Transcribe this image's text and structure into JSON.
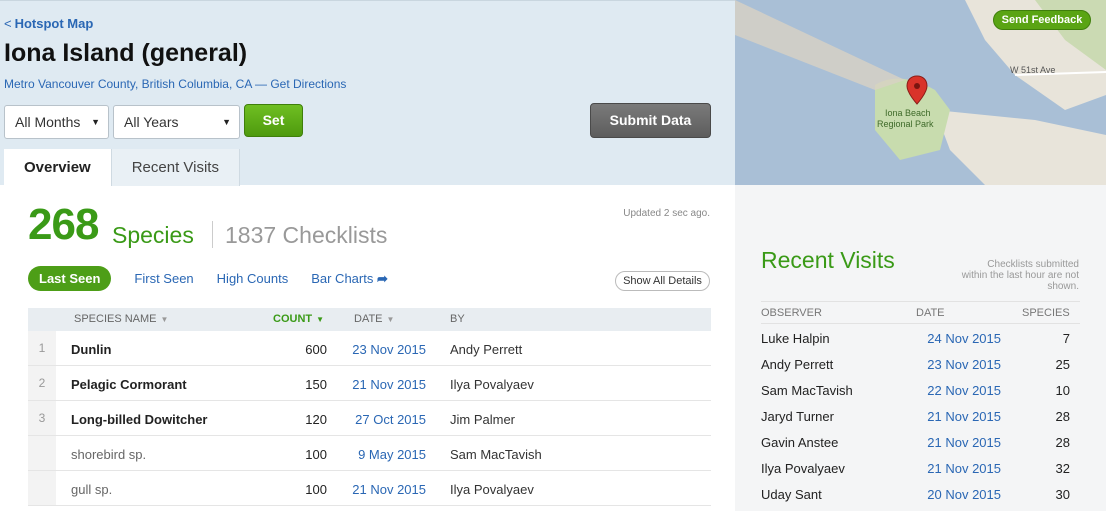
{
  "header": {
    "back_link": "Hotspot Map",
    "title": "Iona Island (general)",
    "location": "Metro Vancouver County, British Columbia, CA",
    "directions": "Get Directions",
    "month_select": "All Months",
    "year_select": "All Years",
    "set_label": "Set",
    "submit_label": "Submit Data"
  },
  "tabs": [
    {
      "label": "Overview"
    },
    {
      "label": "Recent Visits"
    }
  ],
  "map": {
    "feedback_label": "Send Feedback",
    "park_label_1": "Iona Beach",
    "park_label_2": "Regional Park",
    "street_label": "W 51st Ave",
    "colors": {
      "water": "#a9bfd6",
      "land": "#e8e4da",
      "park": "#c8dcae",
      "marker": "#d9332a"
    }
  },
  "stats": {
    "species_count": "268",
    "species_label": "Species",
    "checklists_label": "1837 Checklists",
    "updated": "Updated 2 sec ago."
  },
  "views": {
    "last_seen": "Last Seen",
    "first_seen": "First Seen",
    "high_counts": "High Counts",
    "bar_charts": "Bar Charts",
    "show_all": "Show All Details"
  },
  "species_table": {
    "headers": {
      "name": "SPECIES NAME",
      "count": "COUNT",
      "date": "DATE",
      "by": "BY"
    },
    "rows": [
      {
        "num": "1",
        "name": "Dunlin",
        "count": "600",
        "date": "23 Nov 2015",
        "by": "Andy Perrett"
      },
      {
        "num": "2",
        "name": "Pelagic Cormorant",
        "count": "150",
        "date": "21 Nov 2015",
        "by": "Ilya Povalyaev"
      },
      {
        "num": "3",
        "name": "Long-billed Dowitcher",
        "count": "120",
        "date": "27 Oct 2015",
        "by": "Jim Palmer"
      },
      {
        "num": "",
        "name": "shorebird sp.",
        "count": "100",
        "date": "9 May 2015",
        "by": "Sam MacTavish"
      },
      {
        "num": "",
        "name": "gull sp.",
        "count": "100",
        "date": "21 Nov 2015",
        "by": "Ilya Povalyaev"
      }
    ]
  },
  "recent_visits": {
    "title": "Recent Visits",
    "note": "Checklists submitted within the last hour are not shown.",
    "headers": {
      "observer": "OBSERVER",
      "date": "DATE",
      "species": "SPECIES"
    },
    "rows": [
      {
        "observer": "Luke Halpin",
        "date": "24 Nov 2015",
        "species": "7"
      },
      {
        "observer": "Andy Perrett",
        "date": "23 Nov 2015",
        "species": "25"
      },
      {
        "observer": "Sam MacTavish",
        "date": "22 Nov 2015",
        "species": "10"
      },
      {
        "observer": "Jaryd Turner",
        "date": "21 Nov 2015",
        "species": "28"
      },
      {
        "observer": "Gavin Anstee",
        "date": "21 Nov 2015",
        "species": "28"
      },
      {
        "observer": "Ilya Povalyaev",
        "date": "21 Nov 2015",
        "species": "32"
      },
      {
        "observer": "Uday Sant",
        "date": "20 Nov 2015",
        "species": "30"
      }
    ]
  },
  "colors": {
    "accent_green": "#3a9a17",
    "link_blue": "#2a67b4"
  }
}
